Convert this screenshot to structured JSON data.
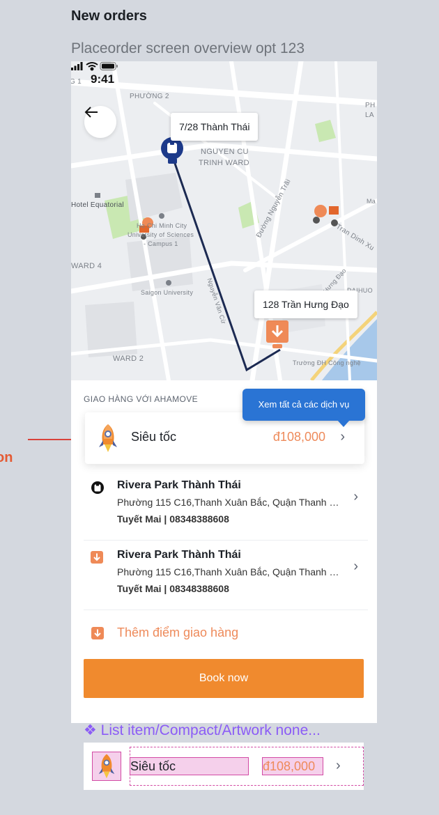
{
  "canvas": {
    "title": "New orders",
    "subtitle": "Placeorder screen overview opt 123",
    "component_label": "❖ List item/Compact/Artwork none...",
    "edge_text": "on"
  },
  "status_bar": {
    "time": "9:41"
  },
  "map": {
    "pickup_label": "7/28 Thành Thái",
    "dropoff_label": "128 Trần Hưng Đạo",
    "labels": {
      "phuong2": "PHƯỜNG 2",
      "nguyen_cu": "NGUYEN CU",
      "trinh_ward": "TRINH WARD",
      "hotel": "Hotel Equatorial",
      "hcm1": "Ho Chi Minh City",
      "hcm2": "University of Sciences",
      "hcm3": "- Campus 1",
      "ward4": "WARD 4",
      "saigon_uni": "Saigon University",
      "ward2": "WARD 2",
      "duong_nguyen_trai": "Đường Nguyễn Trãi",
      "tran_dinh_xu": "Tran Dinh Xu",
      "hung_dao": "Hưng Đạo",
      "nguyen_van_cu": "Nguyễn Văn Cừ",
      "truong_dh": "Trường ĐH Công nghệ",
      "frag1": "G 1",
      "frag2": "PH",
      "frag3": "LA",
      "frag4": "Ma",
      "frag5": "HUO",
      "frag6": "DAI"
    }
  },
  "panel": {
    "section_label": "GIAO HÀNG VỚI AHAMOVE",
    "tooltip": "Xem tất cả các dịch vụ",
    "service": {
      "name": "Siêu tốc",
      "price": "đ108,000"
    },
    "stops": [
      {
        "type": "pickup",
        "title": "Rivera Park Thành Thái",
        "address": "Phường 115 C16,Thanh Xuân Bắc, Quận Thanh Xuân",
        "contact": "Tuyết Mai | 08348388608"
      },
      {
        "type": "dropoff",
        "title": "Rivera Park Thành Thái",
        "address": "Phường 115 C16,Thanh Xuân Bắc, Quận Thanh Xuân",
        "contact": "Tuyết Mai | 08348388608"
      }
    ],
    "add_stop": "Thêm điểm giao hàng",
    "book_button": "Book now"
  },
  "mini_card": {
    "name": "Siêu tốc",
    "price": "đ108,000"
  },
  "colors": {
    "accent_orange": "#f08a2e",
    "price_orange": "#ee8a5a",
    "tooltip_blue": "#2a74d4",
    "route_navy": "#1c2a52",
    "pickup_pin": "#1d3a8a"
  },
  "icons": {
    "back": "arrow-left-icon",
    "signal": "signal-icon",
    "wifi": "wifi-icon",
    "battery": "battery-icon",
    "service": "rocket-icon",
    "pickup": "pickup-pin-icon",
    "dropoff": "dropoff-pin-icon",
    "chevron": "chevron-right-icon"
  }
}
